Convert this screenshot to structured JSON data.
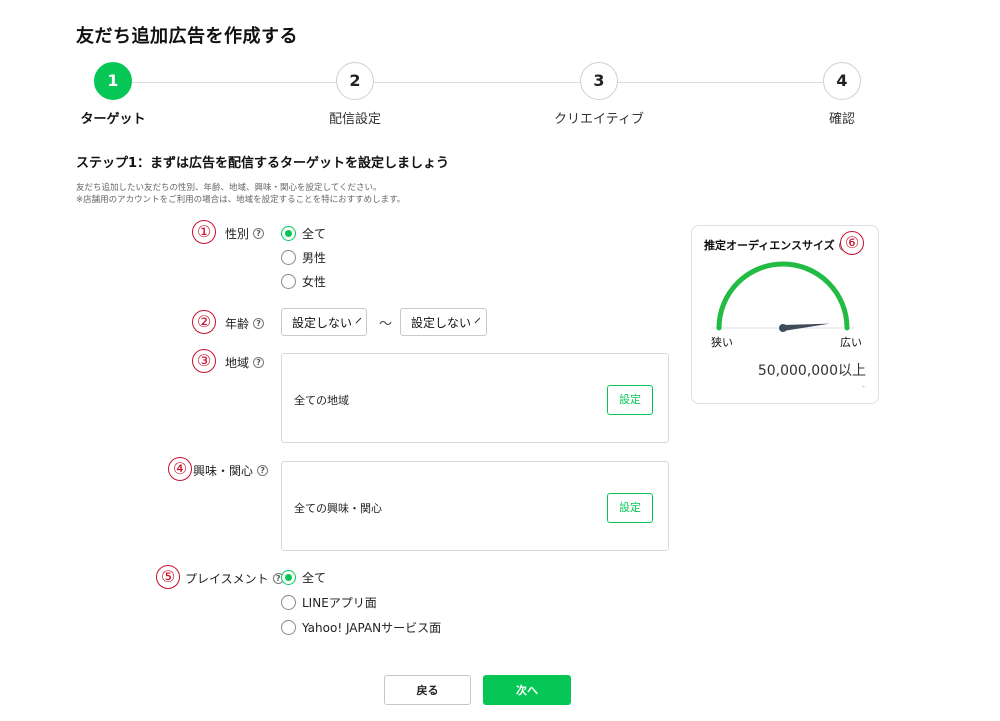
{
  "page_title": "友だち追加広告を作成する",
  "steps": [
    {
      "number": "1",
      "label": "ターゲット"
    },
    {
      "number": "2",
      "label": "配信設定"
    },
    {
      "number": "3",
      "label": "クリエイティブ"
    },
    {
      "number": "4",
      "label": "確認"
    }
  ],
  "step_heading": "ステップ1：まずは広告を配信するターゲットを設定しましょう",
  "description": [
    "友だち追加したい友だちの性別、年齢、地域、興味・関心を設定してください。",
    "※店舗用のアカウントをご利用の場合は、地域を設定することを特におすすめします。"
  ],
  "markers": [
    "①",
    "②",
    "③",
    "④",
    "⑤",
    "⑥"
  ],
  "help_icon": "?",
  "gender": {
    "label": "性別",
    "options": [
      "全て",
      "男性",
      "女性"
    ],
    "selected": "全て"
  },
  "age": {
    "label": "年齢",
    "from": "設定しない",
    "to": "設定しない",
    "separator": "～"
  },
  "region": {
    "label": "地域",
    "value": "全ての地域",
    "button": "設定"
  },
  "interests": {
    "label": "興味・関心",
    "value": "全ての興味・関心",
    "button": "設定"
  },
  "placement": {
    "label": "プレイスメント",
    "options": [
      "全て",
      "LINEアプリ面",
      "Yahoo! JAPANサービス面"
    ],
    "selected": "全て"
  },
  "audience": {
    "title": "推定オーディエンスサイズ",
    "narrow_label": "狭い",
    "wide_label": "広い",
    "value": "50,000,000以上",
    "dash": "-",
    "level": 0.97
  },
  "buttons": {
    "back": "戻る",
    "next": "次へ"
  },
  "colors": {
    "accent": "#06c755",
    "marker": "#c8102e"
  }
}
